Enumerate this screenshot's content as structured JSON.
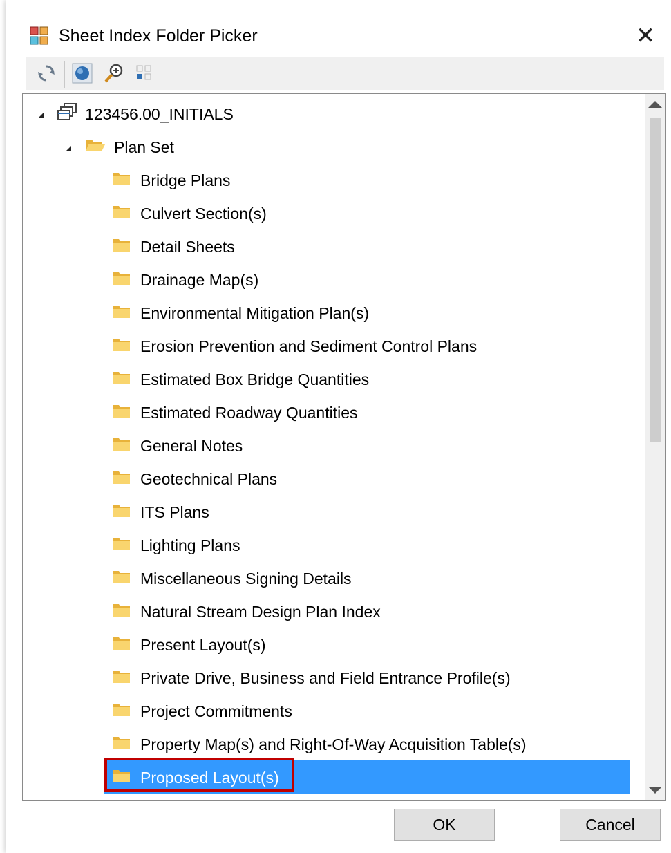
{
  "window": {
    "title": "Sheet Index Folder Picker",
    "close_symbol": "✕",
    "app_icon": "sheet-index-app-icon"
  },
  "toolbar": {
    "buttons": [
      {
        "name": "refresh-icon"
      },
      {
        "name": "globe-icon"
      },
      {
        "name": "zoom-icon"
      },
      {
        "name": "grid-view-icon"
      }
    ]
  },
  "tree": {
    "root": {
      "label": "123456.00_INITIALS",
      "icon": "project-icon",
      "expanded": true
    },
    "plan_set": {
      "label": "Plan Set",
      "icon": "open-folder-icon",
      "expanded": true
    },
    "folders": [
      "Bridge Plans",
      "Culvert Section(s)",
      "Detail Sheets",
      "Drainage Map(s)",
      "Environmental Mitigation Plan(s)",
      "Erosion Prevention and Sediment Control Plans",
      "Estimated Box Bridge Quantities",
      "Estimated Roadway Quantities",
      "General Notes",
      "Geotechnical Plans",
      "ITS Plans",
      "Lighting Plans",
      "Miscellaneous Signing Details",
      "Natural Stream Design Plan Index",
      "Present Layout(s)",
      "Private Drive, Business and Field Entrance Profile(s)",
      "Project Commitments",
      "Property Map(s) and Right-Of-Way Acquisition Table(s)",
      "Proposed Layout(s)"
    ],
    "selected": "Proposed Layout(s)"
  },
  "buttons": {
    "ok": "OK",
    "cancel": "Cancel"
  },
  "colors": {
    "selection": "#3399ff",
    "highlight_border": "#c00000",
    "folder": "#f4c430"
  }
}
